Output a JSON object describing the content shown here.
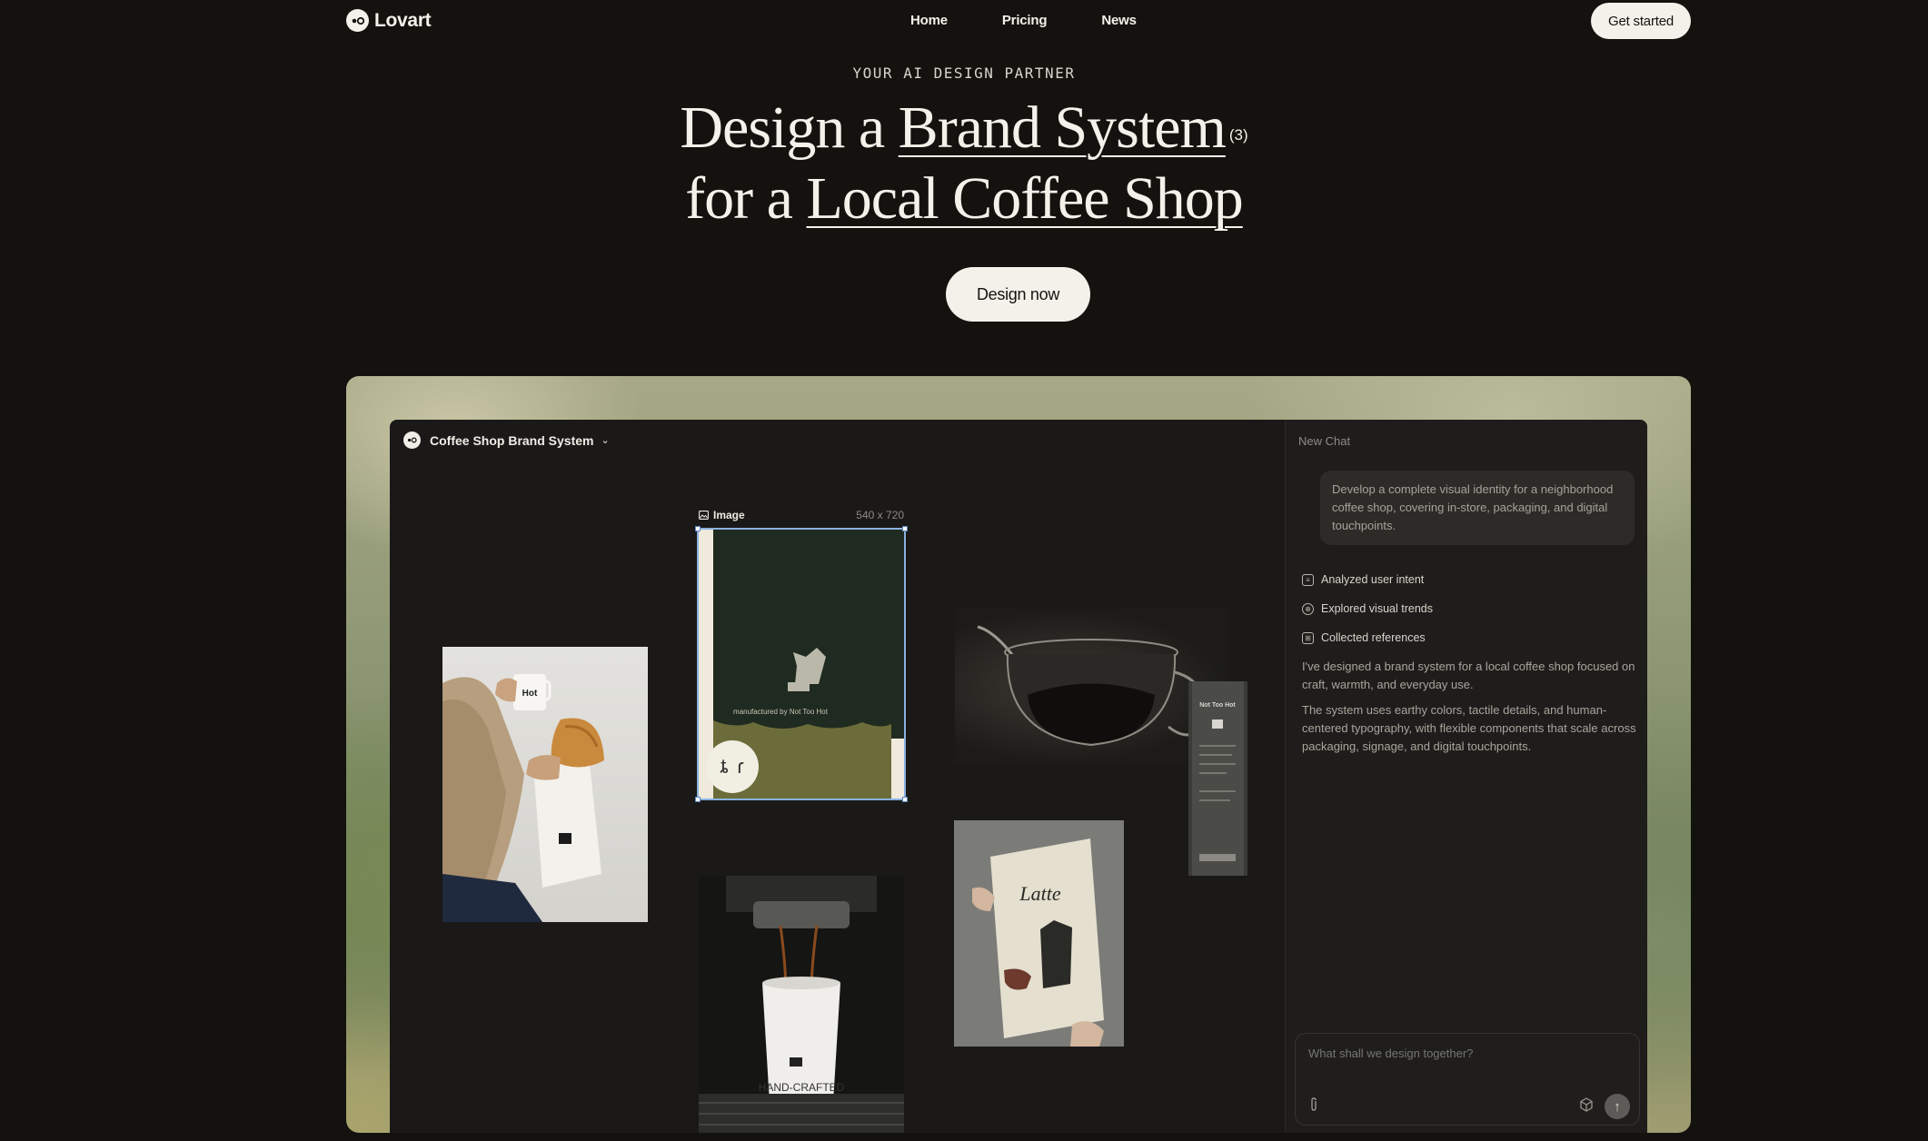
{
  "nav": {
    "brand": "Lovart",
    "links": [
      "Home",
      "Pricing",
      "News"
    ],
    "cta": "Get started"
  },
  "hero": {
    "eyebrow": "YOUR AI DESIGN PARTNER",
    "line1_prefix": "Design a ",
    "line1_emph": "Brand System",
    "footnote": "(3)",
    "line2_prefix": "for a ",
    "line2_emph": "Local Coffee Shop",
    "button": "Design now"
  },
  "app": {
    "project_title": "Coffee Shop Brand System",
    "image_label": "Image",
    "image_dims": "540 x 720",
    "cup_brand_text": "Hot",
    "poster_text": "Latte",
    "handcrafted": "HAND-CRAFTED",
    "package_text": "manufactured by Not Too Hot",
    "receipt_text": "Not Too Hot"
  },
  "chat": {
    "title": "New Chat",
    "prompt": "Develop a complete visual identity for a neighborhood coffee shop, covering in-store, packaging, and digital touchpoints.",
    "steps": [
      "Analyzed user intent",
      "Explored visual trends",
      "Collected references"
    ],
    "reply": [
      "I've designed a brand system for a local coffee shop focused on craft, warmth, and everyday use.",
      "The system uses earthy colors, tactile details, and human-centered typography, with flexible components that scale across packaging, signage, and digital touchpoints."
    ],
    "input_placeholder": "What shall we design together?"
  }
}
